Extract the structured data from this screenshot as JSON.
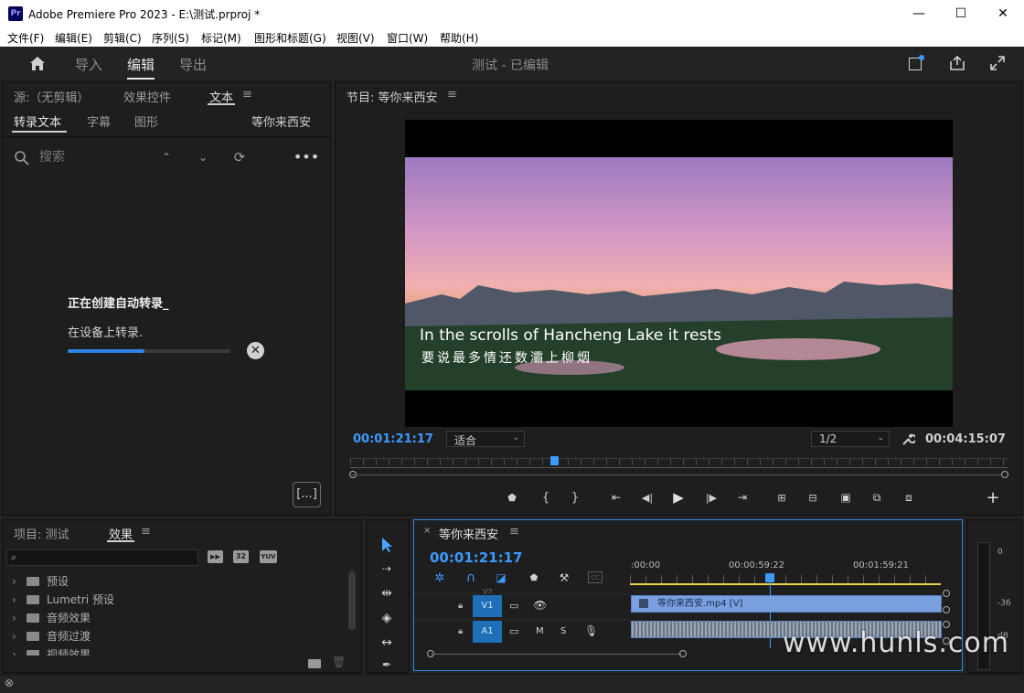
{
  "window": {
    "title": "Adobe Premiere Pro 2023 - E:\\测试.prproj *",
    "logo": "Pr",
    "minimize": "—",
    "maximize": "☐",
    "close": "✕"
  },
  "menu": [
    "文件(F)",
    "编辑(E)",
    "剪辑(C)",
    "序列(S)",
    "标记(M)",
    "图形和标题(G)",
    "视图(V)",
    "窗口(W)",
    "帮助(H)"
  ],
  "workspace": {
    "tabs": [
      "导入",
      "编辑",
      "导出"
    ],
    "active": 1,
    "project_title": "测试 - 已编辑"
  },
  "source_panel": {
    "tabs": [
      "源:（无剪辑）",
      "效果控件",
      "文本"
    ],
    "subtabs": [
      "转录文本",
      "字幕",
      "图形"
    ],
    "sequence_name": "等你来西安",
    "search_placeholder": "搜索",
    "status_title": "正在创建自动转录_",
    "status_sub": "在设备上转录.",
    "progress": 0.47,
    "caption_btn": "[...]"
  },
  "program_monitor": {
    "title": "节目: 等你来西安",
    "subtitle_en": "In the scrolls of Hancheng Lake it rests",
    "subtitle_cn": "要说最多情还数灞上柳烟",
    "timecode": "00:01:21:17",
    "fit": "适合",
    "resolution": "1/2",
    "duration": "00:04:15:07",
    "playhead": 0.31
  },
  "project_panel": {
    "tabs": [
      "项目: 测试",
      "效果"
    ],
    "items": [
      "预设",
      "Lumetri 预设",
      "音频效果",
      "音频过渡",
      "视频效果"
    ],
    "badges": [
      "32",
      "YUV"
    ]
  },
  "timeline": {
    "tab": "等你来西安",
    "timecode": "00:01:21:17",
    "ruler": [
      ":00:00",
      "00:00:59:22",
      "00:01:59:21"
    ],
    "tracks": {
      "v1": "V1",
      "a1": "A1",
      "v2": "V2",
      "m": "M",
      "s": "S"
    },
    "clip_name": "等你来西安.mp4 [V]",
    "playhead": 0.45
  },
  "meter": {
    "labels": [
      "0",
      "-36",
      "dB"
    ]
  },
  "watermark": "www.hunls.com",
  "colors": {
    "accent": "#3b9bff",
    "clip": "#7aa0e0"
  }
}
